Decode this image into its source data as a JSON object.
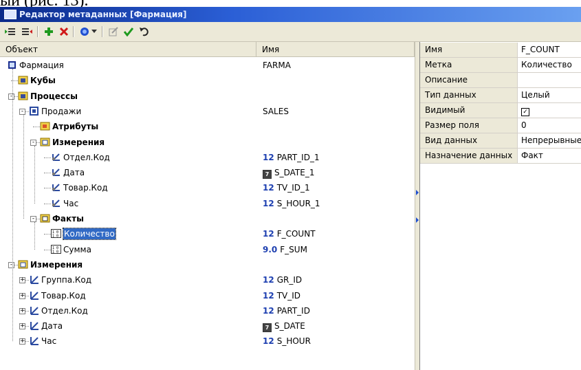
{
  "doc_caption": "ый (рис. 13).",
  "window": {
    "title": "Редактор метаданных [Фармация]"
  },
  "toolbar": {
    "icons": [
      "indent-icon",
      "outdent-icon",
      "add-icon",
      "delete-icon",
      "refresh-icon",
      "dropdown-icon",
      "edit-icon",
      "apply-icon",
      "undo-icon"
    ]
  },
  "tree": {
    "columns": [
      "Объект",
      "Имя"
    ],
    "rows": [
      {
        "label": "Фармация",
        "name": "FARMA",
        "tag": "",
        "bold": false,
        "icon": "database-icon"
      },
      {
        "label": "Кубы",
        "name": "",
        "tag": "",
        "bold": true,
        "icon": "folder-icon"
      },
      {
        "label": "Процессы",
        "name": "",
        "tag": "",
        "bold": true,
        "icon": "folder-icon"
      },
      {
        "label": "Продажи",
        "name": "SALES",
        "tag": "",
        "bold": false,
        "icon": "process-icon"
      },
      {
        "label": "Атрибуты",
        "name": "",
        "tag": "",
        "bold": true,
        "icon": "attributes-folder-icon"
      },
      {
        "label": "Измерения",
        "name": "",
        "tag": "",
        "bold": true,
        "icon": "dimensions-folder-icon"
      },
      {
        "label": "Отдел.Код",
        "name": "PART_ID_1",
        "tag": "12",
        "bold": false,
        "icon": "dimension-link-icon"
      },
      {
        "label": "Дата",
        "name": "S_DATE_1",
        "tag": "7",
        "bold": false,
        "icon": "dimension-link-icon"
      },
      {
        "label": "Товар.Код",
        "name": "TV_ID_1",
        "tag": "12",
        "bold": false,
        "icon": "dimension-link-icon"
      },
      {
        "label": "Час",
        "name": "S_HOUR_1",
        "tag": "12",
        "bold": false,
        "icon": "dimension-link-icon"
      },
      {
        "label": "Факты",
        "name": "",
        "tag": "",
        "bold": true,
        "icon": "facts-folder-icon"
      },
      {
        "label": "Количество",
        "name": "F_COUNT",
        "tag": "12",
        "bold": false,
        "icon": "fact-icon"
      },
      {
        "label": "Сумма",
        "name": "F_SUM",
        "tag": "9.0",
        "bold": false,
        "icon": "fact-icon"
      },
      {
        "label": "Измерения",
        "name": "",
        "tag": "",
        "bold": true,
        "icon": "dimensions-folder-icon"
      },
      {
        "label": "Группа.Код",
        "name": "GR_ID",
        "tag": "12",
        "bold": false,
        "icon": "dimension-icon"
      },
      {
        "label": "Товар.Код",
        "name": "TV_ID",
        "tag": "12",
        "bold": false,
        "icon": "dimension-icon"
      },
      {
        "label": "Отдел.Код",
        "name": "PART_ID",
        "tag": "12",
        "bold": false,
        "icon": "dimension-icon"
      },
      {
        "label": "Дата",
        "name": "S_DATE",
        "tag": "7",
        "bold": false,
        "icon": "dimension-icon"
      },
      {
        "label": "Час",
        "name": "S_HOUR",
        "tag": "12",
        "bold": false,
        "icon": "dimension-icon"
      }
    ]
  },
  "properties": [
    {
      "key": "Имя",
      "value": "F_COUNT"
    },
    {
      "key": "Метка",
      "value": "Количество"
    },
    {
      "key": "Описание",
      "value": ""
    },
    {
      "key": "Тип данных",
      "value": "Целый"
    },
    {
      "key": "Видимый",
      "value": "☑"
    },
    {
      "key": "Размер поля",
      "value": "0"
    },
    {
      "key": "Вид данных",
      "value": "Непрерывные"
    },
    {
      "key": "Назначение данных",
      "value": "Факт"
    }
  ],
  "colors": {
    "selection": "#316ac5",
    "tag": "#1d3fb0",
    "chrome": "#ece9d8"
  }
}
